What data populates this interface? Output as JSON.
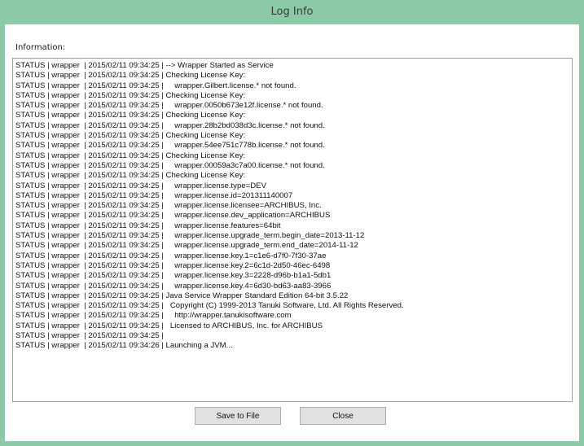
{
  "window": {
    "title": "Log Info"
  },
  "info_label": "Information:",
  "log_lines": [
    "STATUS | wrapper  | 2015/02/11 09:34:25 | --> Wrapper Started as Service",
    "STATUS | wrapper  | 2015/02/11 09:34:25 | Checking License Key:",
    "STATUS | wrapper  | 2015/02/11 09:34:25 |     wrapper.Gilbert.license.* not found.",
    "STATUS | wrapper  | 2015/02/11 09:34:25 | Checking License Key:",
    "STATUS | wrapper  | 2015/02/11 09:34:25 |     wrapper.0050b673e12f.license.* not found.",
    "STATUS | wrapper  | 2015/02/11 09:34:25 | Checking License Key:",
    "STATUS | wrapper  | 2015/02/11 09:34:25 |     wrapper.28b2bd038d3c.license.* not found.",
    "STATUS | wrapper  | 2015/02/11 09:34:25 | Checking License Key:",
    "STATUS | wrapper  | 2015/02/11 09:34:25 |     wrapper.54ee751c778b.license.* not found.",
    "STATUS | wrapper  | 2015/02/11 09:34:25 | Checking License Key:",
    "STATUS | wrapper  | 2015/02/11 09:34:25 |     wrapper.00059a3c7a00.license.* not found.",
    "STATUS | wrapper  | 2015/02/11 09:34:25 | Checking License Key:",
    "STATUS | wrapper  | 2015/02/11 09:34:25 |     wrapper.license.type=DEV",
    "STATUS | wrapper  | 2015/02/11 09:34:25 |     wrapper.license.id=201311140007",
    "STATUS | wrapper  | 2015/02/11 09:34:25 |     wrapper.license.licensee=ARCHIBUS, Inc.",
    "STATUS | wrapper  | 2015/02/11 09:34:25 |     wrapper.license.dev_application=ARCHIBUS",
    "STATUS | wrapper  | 2015/02/11 09:34:25 |     wrapper.license.features=64bit",
    "STATUS | wrapper  | 2015/02/11 09:34:25 |     wrapper.license.upgrade_term.begin_date=2013-11-12",
    "STATUS | wrapper  | 2015/02/11 09:34:25 |     wrapper.license.upgrade_term.end_date=2014-11-12",
    "STATUS | wrapper  | 2015/02/11 09:34:25 |     wrapper.license.key.1=c1e6-d7f0-7f30-37ae",
    "STATUS | wrapper  | 2015/02/11 09:34:25 |     wrapper.license.key.2=6c1d-2d50-46ec-6498",
    "STATUS | wrapper  | 2015/02/11 09:34:25 |     wrapper.license.key.3=2228-d96b-b1a1-5db1",
    "STATUS | wrapper  | 2015/02/11 09:34:25 |     wrapper.license.key.4=6d30-bd63-aa83-3966",
    "STATUS | wrapper  | 2015/02/11 09:34:25 | Java Service Wrapper Standard Edition 64-bit 3.5.22",
    "STATUS | wrapper  | 2015/02/11 09:34:25 |   Copyright (C) 1999-2013 Tanuki Software, Ltd. All Rights Reserved.",
    "STATUS | wrapper  | 2015/02/11 09:34:25 |     http://wrapper.tanukisoftware.com",
    "STATUS | wrapper  | 2015/02/11 09:34:25 |   Licensed to ARCHIBUS, Inc. for ARCHIBUS",
    "STATUS | wrapper  | 2015/02/11 09:34:25 |",
    "STATUS | wrapper  | 2015/02/11 09:34:26 | Launching a JVM..."
  ],
  "buttons": {
    "save_label": "Save to File",
    "close_label": "Close"
  },
  "colors": {
    "frame": "#8cc9a6",
    "button_bg": "#e1e1e1",
    "button_border": "#adadad"
  }
}
